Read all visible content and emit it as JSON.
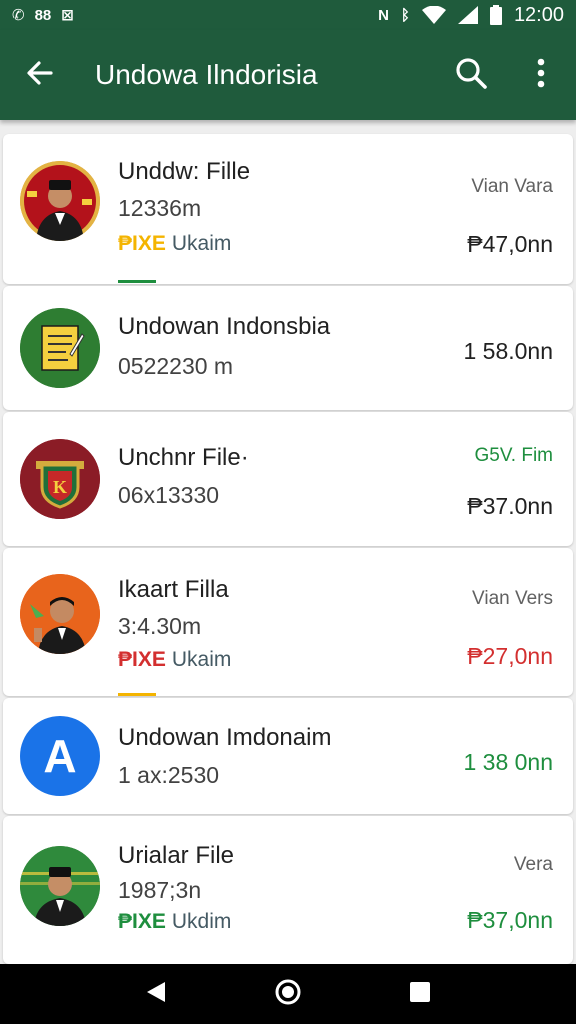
{
  "status_bar": {
    "left_icons": [
      "whatsapp-icon",
      "settings-icon",
      "app-icon"
    ],
    "left_glyphs": [
      "✆",
      "88",
      "⊠"
    ],
    "right_icons": [
      "nfc-icon",
      "bluetooth-icon",
      "wifi-icon",
      "signal-icon",
      "battery-icon"
    ],
    "right_glyphs": [
      "N",
      "ᛒ"
    ],
    "time": "12:00"
  },
  "app_bar": {
    "title": "Undowa Ilndorisia",
    "back_icon": "arrow-back-icon",
    "search_icon": "search-icon",
    "menu_icon": "more-vert-icon"
  },
  "items": [
    {
      "title": "Unddw: Fille",
      "subtitle": "12336m",
      "tag_code": "₱IXE",
      "tag_label": "Ukaim",
      "tag_color": "#f4b400",
      "meta": "Vian Vara",
      "amount": "₱47,0nn",
      "amount_color": "#212121",
      "avatar_icon": "official-portrait-icon",
      "accent_color": "#1e8e3e"
    },
    {
      "title": "Undowan Indonsbia",
      "subtitle": "0522230 m",
      "amount": "1 58.0nn",
      "amount_color": "#212121",
      "avatar_icon": "document-icon"
    },
    {
      "title": "Unchnr File·",
      "subtitle": "06x13330",
      "meta": "G5V. Fim",
      "meta_color": "#1e8e3e",
      "amount": "₱37.0nn",
      "amount_color": "#212121",
      "avatar_icon": "emblem-shield-icon"
    },
    {
      "title": "Ikaart Filla",
      "subtitle": "3:4.30m",
      "tag_code": "₱IXE",
      "tag_label": "Ukaim",
      "tag_color": "#d32f2f",
      "meta": "Vian Vers",
      "amount": "₱27,0nn",
      "amount_color": "#d32f2f",
      "avatar_icon": "person-portrait-icon",
      "accent_color": "#f4b400"
    },
    {
      "title": "Undowan Imdonaim",
      "subtitle": "1 ax:2530",
      "amount": "1 38 0nn",
      "amount_color": "#1e8e3e",
      "avatar_icon": "letter-a-icon",
      "avatar_letter": "A"
    },
    {
      "title": "Urialar File",
      "subtitle": "1987;3n",
      "tag_code": "₱IXE",
      "tag_label": "Ukdim",
      "tag_color": "#1e8e3e",
      "meta": "Vera",
      "amount": "₱37,0nn",
      "amount_color": "#1e8e3e",
      "avatar_icon": "official-portrait-icon"
    }
  ],
  "nav_bar": {
    "back_icon": "nav-back-icon",
    "home_icon": "nav-home-icon",
    "recents_icon": "nav-recents-icon"
  },
  "colors": {
    "app_bar": "#1f5b3c",
    "background": "#eeeeee",
    "accent_green": "#1e8e3e"
  }
}
